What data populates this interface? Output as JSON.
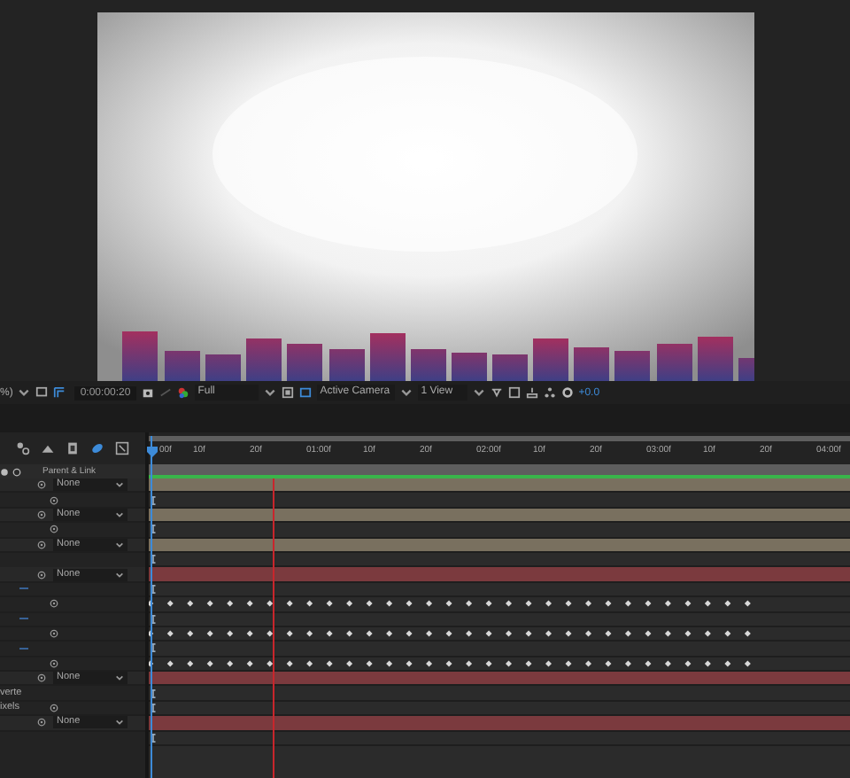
{
  "viewer_toolbar": {
    "zoom": "%)",
    "timecode": "0:00:00:20",
    "resolution": "Full",
    "camera": "Active Camera",
    "views": "1 View",
    "exposure": "+0.0"
  },
  "timeline": {
    "ruler": [
      "00f",
      "10f",
      "20f",
      "01:00f",
      "10f",
      "20f",
      "02:00f",
      "10f",
      "20f",
      "03:00f",
      "10f",
      "20f",
      "04:00f"
    ],
    "column_header": "Parent & Link",
    "rows": [
      {
        "kind": "layer",
        "parent": "None",
        "color": "#79705f"
      },
      {
        "kind": "property"
      },
      {
        "kind": "layer",
        "parent": "None",
        "color": "#79705f"
      },
      {
        "kind": "property"
      },
      {
        "kind": "layer",
        "parent": "None",
        "color": "#79705f"
      },
      {
        "kind": "blank"
      },
      {
        "kind": "layer",
        "parent": "None",
        "color": "#7b3a3e"
      },
      {
        "kind": "expression"
      },
      {
        "kind": "keyframed"
      },
      {
        "kind": "expression"
      },
      {
        "kind": "keyframed"
      },
      {
        "kind": "expression"
      },
      {
        "kind": "keyframed"
      },
      {
        "kind": "layer",
        "parent": "None",
        "color": "#7b3a3e"
      },
      {
        "kind": "label",
        "name": "verte"
      },
      {
        "kind": "property",
        "name": "ixels"
      },
      {
        "kind": "layer",
        "parent": "None",
        "color": "#7b3a3e"
      },
      {
        "kind": "blank"
      }
    ]
  }
}
